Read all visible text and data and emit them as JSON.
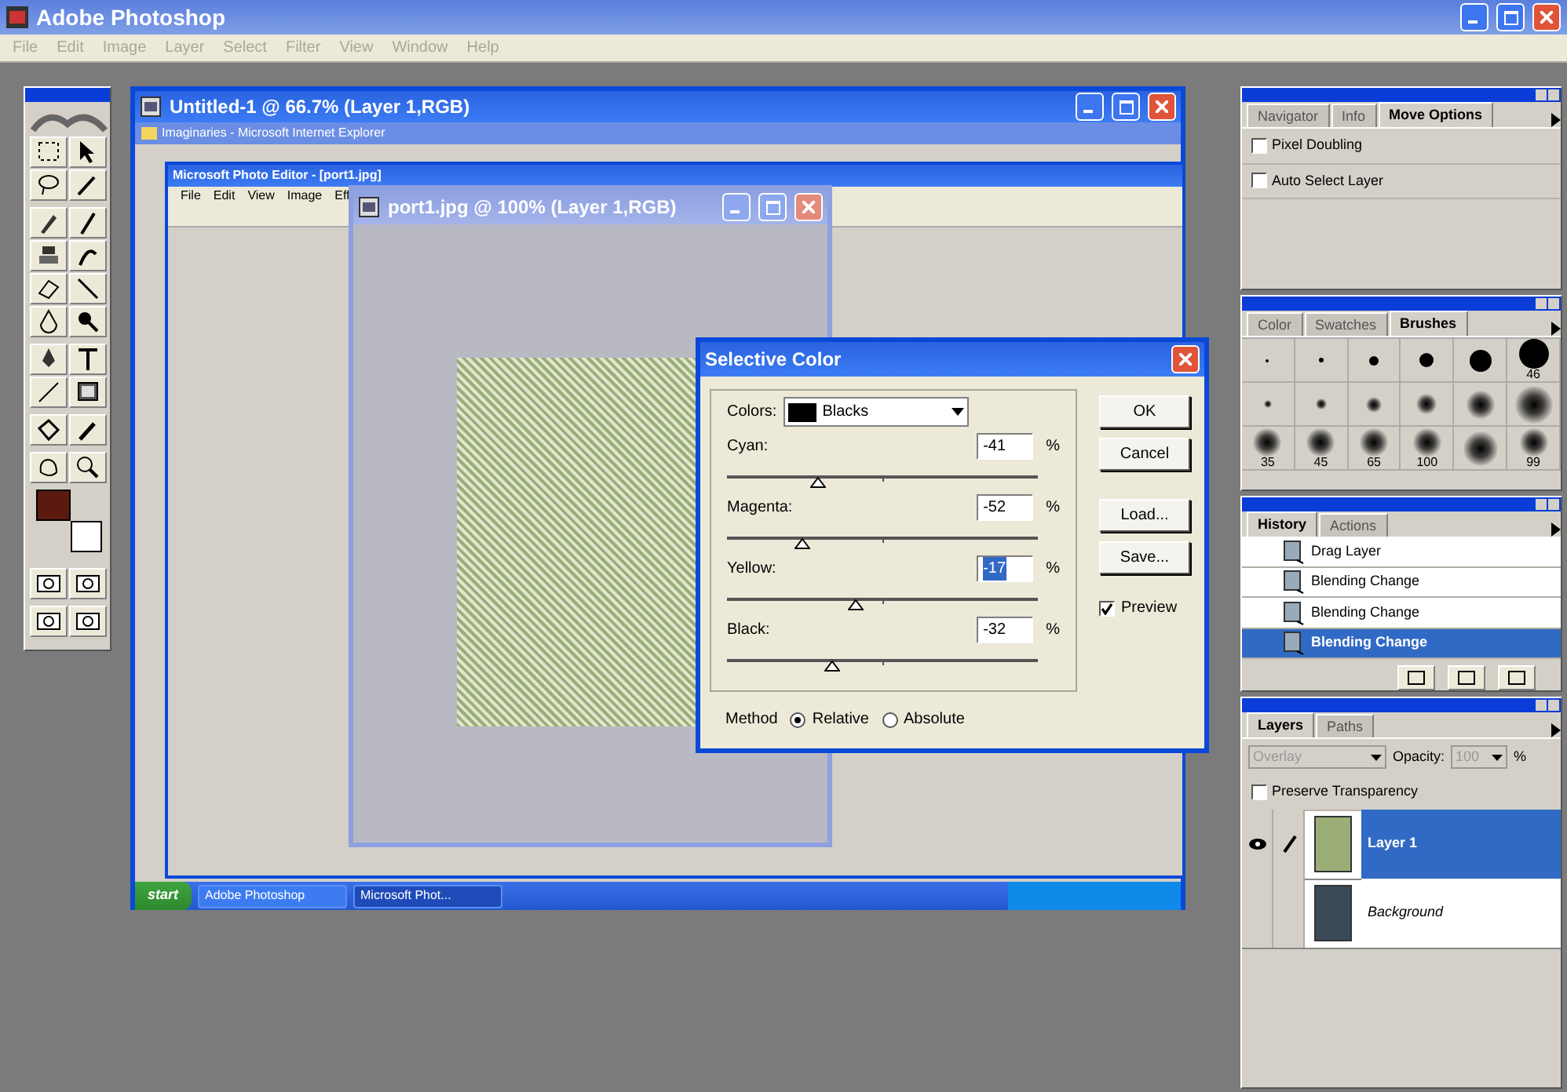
{
  "app": {
    "title": "Adobe Photoshop",
    "menu": [
      "File",
      "Edit",
      "Image",
      "Layer",
      "Select",
      "Filter",
      "View",
      "Window",
      "Help"
    ]
  },
  "toolbox": {
    "foreground": {
      "color": "#5a1a10"
    },
    "background": {
      "color": "#ffffff"
    }
  },
  "document_window": {
    "title": "Untitled-1 @ 66.7% (Layer 1,RGB)"
  },
  "browser_window": {
    "title": "Imaginaries - Microsoft Internet Explorer"
  },
  "photo_editor": {
    "title": "Microsoft Photo Editor - [port1.jpg]",
    "menu": [
      "File",
      "Edit",
      "View",
      "Image",
      "Eff"
    ]
  },
  "image_window": {
    "title": "port1.jpg @ 100% (Layer 1,RGB)"
  },
  "taskbar": {
    "start": "start",
    "items": [
      {
        "label": "Adobe Photoshop",
        "selected": false
      },
      {
        "label": "Microsoft Phot...",
        "selected": true
      }
    ]
  },
  "dialog": {
    "title": "Selective Color",
    "colors_label": "Colors:",
    "colors_value": "Blacks",
    "sliders": [
      {
        "label": "Cyan:",
        "value": "-41",
        "unit": "%",
        "level": 0.295,
        "highlighted": false
      },
      {
        "label": "Magenta:",
        "value": "-52",
        "unit": "%",
        "level": 0.24,
        "highlighted": false
      },
      {
        "label": "Yellow:",
        "value": "-17",
        "unit": "%",
        "level": 0.415,
        "highlighted": true
      },
      {
        "label": "Black:",
        "value": "-32",
        "unit": "%",
        "level": 0.34,
        "highlighted": false
      }
    ],
    "buttons": [
      "OK",
      "Cancel",
      "Load...",
      "Save..."
    ],
    "preview": {
      "label": "Preview",
      "checked": true
    },
    "method": {
      "label": "Method",
      "options": [
        {
          "label": "Relative",
          "selected": true
        },
        {
          "label": "Absolute",
          "selected": false
        }
      ]
    }
  },
  "navigator_palette": {
    "tabs": [
      {
        "label": "Navigator",
        "selected": false
      },
      {
        "label": "Info",
        "selected": false
      },
      {
        "label": "Move Options",
        "selected": true
      }
    ],
    "options": [
      {
        "label": "Pixel Doubling",
        "checked": false
      },
      {
        "label": "Auto Select Layer",
        "checked": false
      }
    ]
  },
  "brushes_palette": {
    "tabs": [
      {
        "label": "Color",
        "selected": false
      },
      {
        "label": "Swatches",
        "selected": false
      },
      {
        "label": "Brushes",
        "selected": true
      }
    ],
    "brushes": [
      {
        "kind": "hard"
      },
      {
        "kind": "hard"
      },
      {
        "kind": "hard"
      },
      {
        "kind": "hard"
      },
      {
        "kind": "hard"
      },
      {
        "kind": "hard",
        "label": "46"
      },
      {
        "kind": "soft"
      },
      {
        "kind": "soft"
      },
      {
        "kind": "soft"
      },
      {
        "kind": "soft"
      },
      {
        "kind": "soft"
      },
      {
        "kind": "soft"
      },
      {
        "kind": "soft",
        "label": "35"
      },
      {
        "kind": "soft",
        "label": "45"
      },
      {
        "kind": "soft",
        "label": "65"
      },
      {
        "kind": "soft",
        "label": "100"
      },
      {
        "kind": "soft"
      },
      {
        "kind": "soft",
        "label": "99"
      }
    ]
  },
  "history_palette": {
    "tabs": [
      {
        "label": "History",
        "selected": true
      },
      {
        "label": "Actions",
        "selected": false
      }
    ],
    "items": [
      {
        "label": "Drag Layer",
        "selected": false
      },
      {
        "label": "Blending Change",
        "selected": false
      },
      {
        "label": "Blending Change",
        "selected": false
      },
      {
        "label": "Blending Change",
        "selected": true
      }
    ]
  },
  "layers_palette": {
    "tabs": [
      {
        "label": "Layers",
        "selected": true
      },
      {
        "label": "Paths",
        "selected": false
      }
    ],
    "blend_mode": {
      "value": "Overlay",
      "disabled": true
    },
    "opacity_label": "Opacity:",
    "opacity": {
      "value": "100",
      "disabled": true
    },
    "opacity_unit": "%",
    "preserve": {
      "label": "Preserve Transparency",
      "checked": false
    },
    "layers": [
      {
        "name": "Layer 1",
        "kind": "layer",
        "selected": true,
        "visible": true
      },
      {
        "name": "Background",
        "kind": "background",
        "selected": false,
        "visible": false
      }
    ]
  }
}
